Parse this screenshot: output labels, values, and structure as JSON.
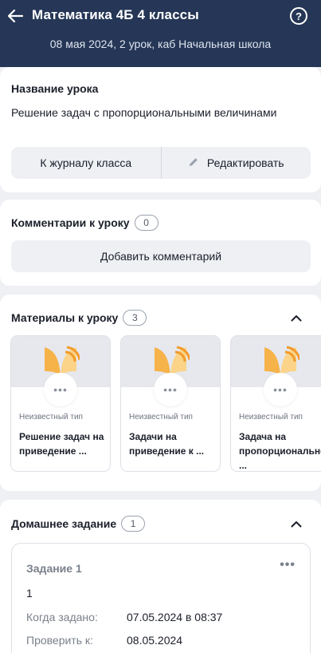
{
  "header": {
    "title": "Математика 4Б 4 классы",
    "subtitle": "08 мая 2024, 2 урок, каб Начальная школа",
    "help_glyph": "?",
    "background": "#253656"
  },
  "lesson": {
    "name_label": "Название урока",
    "name_value": "Решение задач с пропорциональными величинами",
    "journal_button": "К журналу класса",
    "edit_button": "Редактировать"
  },
  "comments": {
    "title": "Комментарии к уроку",
    "count": "0",
    "add_button": "Добавить комментарий"
  },
  "materials": {
    "title": "Материалы к уроку",
    "count": "3",
    "items": [
      {
        "type": "Неизвестный тип",
        "name": "Решение задач на приведение ..."
      },
      {
        "type": "Неизвестный тип",
        "name": "Задачи на приведение к ..."
      },
      {
        "type": "Неизвестный тип",
        "name": "Задача на пропорциональное ..."
      }
    ]
  },
  "homework": {
    "title": "Домашнее задание",
    "count": "1",
    "task": {
      "title": "Задание 1",
      "body": "1",
      "assigned_label": "Когда задано:",
      "assigned_value": "07.05.2024 в 08:37",
      "check_label": "Проверить к:",
      "check_value": "08.05.2024"
    }
  },
  "icons": {
    "back": "arrow-left-icon",
    "help": "question-circle-icon",
    "edit": "pencil-icon",
    "collapse": "chevron-up-icon",
    "more": "more-dots-icon",
    "material": "book-logo-icon"
  },
  "colors": {
    "accent_orange": "#f6b34a",
    "logo_blue": "#5a8fc9",
    "page_bg": "#eef0f4"
  }
}
